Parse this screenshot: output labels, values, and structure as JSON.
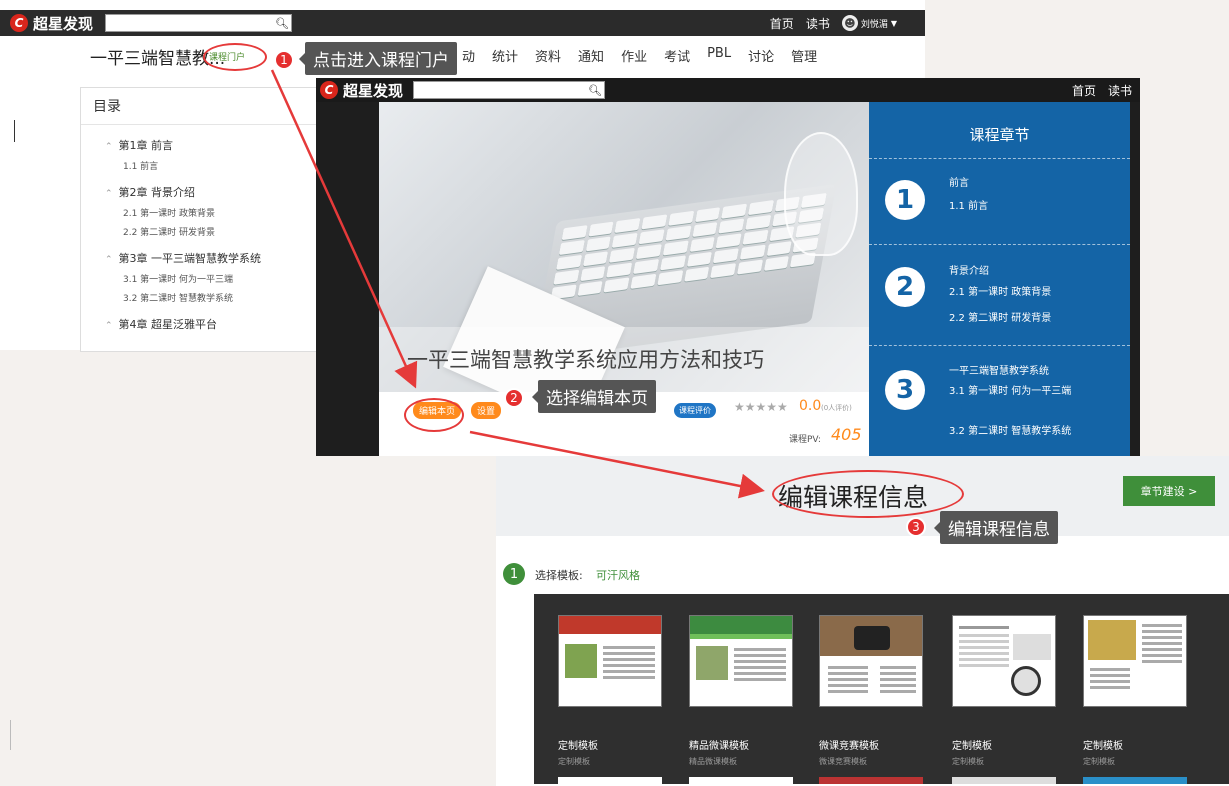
{
  "topbar": {
    "brand": "超星发现",
    "home": "首页",
    "read": "读书",
    "user": "刘悦湄"
  },
  "course": {
    "title": "一平三端智慧教...",
    "portal_link": "课程门户",
    "nav": [
      "统计",
      "资料",
      "通知",
      "作业",
      "考试",
      "PBL",
      "讨论",
      "管理"
    ],
    "nav_partial": "动",
    "toc_title": "目录",
    "chapters": [
      {
        "title": "第1章 前言",
        "sections": [
          "1.1 前言"
        ]
      },
      {
        "title": "第2章 背景介绍",
        "sections": [
          "2.1 第一课时 政策背景",
          "2.2 第二课时 研发背景"
        ]
      },
      {
        "title": "第3章 一平三端智慧教学系统",
        "sections": [
          "3.1 第一课时 何为一平三端",
          "3.2 第二课时 智慧教学系统"
        ]
      },
      {
        "title": "第4章 超星泛雅平台",
        "sections": []
      }
    ]
  },
  "portal": {
    "brand": "超星发现",
    "home": "首页",
    "read": "读书",
    "hero_title": "一平三端智慧教学系统应用方法和技巧",
    "edit_btn": "编辑本页",
    "settings_btn": "设置",
    "rate_btn": "课程评价",
    "stars": "★★★★★",
    "score": "0.0",
    "rating_count": "(0人评价)",
    "pv_label": "课程PV:",
    "pv_value": "405",
    "panel_title": "课程章节",
    "panel_chapters": [
      {
        "num": "1",
        "name": "前言",
        "sections": [
          "1.1 前言"
        ]
      },
      {
        "num": "2",
        "name": "背景介绍",
        "sections": [
          "2.1 第一课时 政策背景",
          "2.2 第二课时 研发背景"
        ]
      },
      {
        "num": "3",
        "name": "一平三端智慧教学系统",
        "sections": [
          "3.1 第一课时 何为一平三端",
          "3.2 第二课时 智慧教学系统"
        ]
      }
    ]
  },
  "edit": {
    "heading": "编辑课程信息",
    "chapter_btn": "章节建设 >",
    "step_num": "1",
    "select_label": "选择模板:",
    "selected_template": "可汗风格",
    "templates": [
      {
        "name": "定制模板",
        "sub": "定制模板"
      },
      {
        "name": "精品微课模板",
        "sub": "精品微课模板"
      },
      {
        "name": "微课竞赛模板",
        "sub": "微课竞赛模板"
      },
      {
        "name": "定制模板",
        "sub": "定制模板"
      },
      {
        "name": "定制模板",
        "sub": "定制模板"
      }
    ]
  },
  "annotations": [
    {
      "num": "1",
      "text": "点击进入课程门户"
    },
    {
      "num": "2",
      "text": "选择编辑本页"
    },
    {
      "num": "3",
      "text": "编辑课程信息"
    }
  ],
  "colors": {
    "accent_red": "#e52f2f",
    "panel_blue": "#1464a6",
    "orange": "#ff8a1c",
    "green": "#3f8f3a"
  }
}
